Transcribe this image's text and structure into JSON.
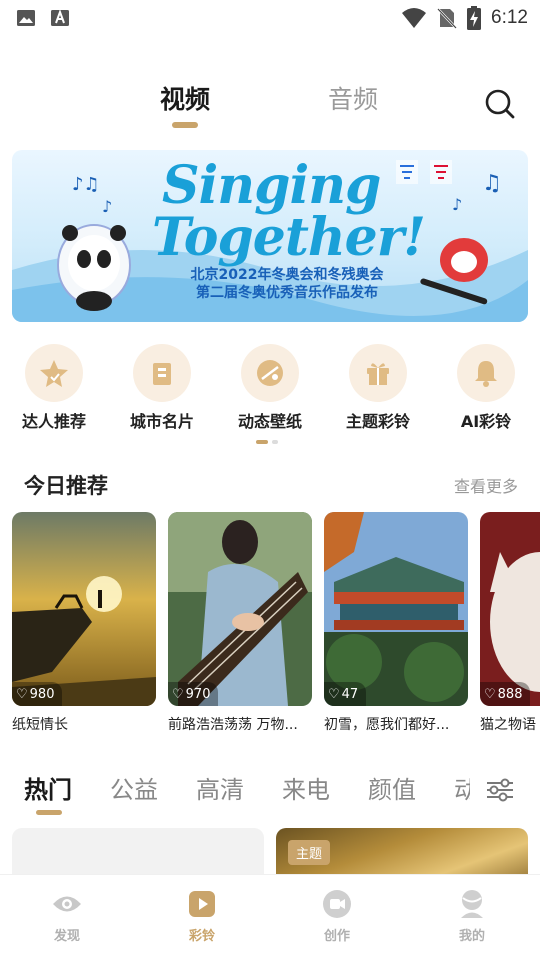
{
  "status_bar": {
    "time": "6:12",
    "icons": [
      "image-icon",
      "text-a-icon",
      "wifi-icon",
      "no-sim-icon",
      "battery-charging-icon"
    ]
  },
  "top_tabs": [
    {
      "label": "视频",
      "active": true
    },
    {
      "label": "音频",
      "active": false
    }
  ],
  "banner": {
    "title_line1": "Singing",
    "title_line2": "Together!",
    "subtitle_line1": "北京2022年冬奥会和冬残奥会",
    "subtitle_line2": "第二届冬奥优秀音乐作品发布"
  },
  "categories": [
    {
      "label": "达人推荐",
      "icon": "star-icon"
    },
    {
      "label": "城市名片",
      "icon": "building-icon"
    },
    {
      "label": "动态壁纸",
      "icon": "wallpaper-icon"
    },
    {
      "label": "主题彩铃",
      "icon": "gift-icon"
    },
    {
      "label": "AI彩铃",
      "icon": "bell-icon"
    }
  ],
  "category_pager": {
    "pages": 2,
    "current": 1
  },
  "today": {
    "title": "今日推荐",
    "more": "查看更多",
    "cards": [
      {
        "title": "纸短情长",
        "likes": "980"
      },
      {
        "title": "前路浩浩荡荡 万物...",
        "likes": "970"
      },
      {
        "title": "初雪，愿我们都好...",
        "likes": "47"
      },
      {
        "title": "猫之物语",
        "likes": "888"
      }
    ]
  },
  "genres": [
    {
      "label": "热门",
      "active": true
    },
    {
      "label": "公益",
      "active": false
    },
    {
      "label": "高清",
      "active": false
    },
    {
      "label": "来电",
      "active": false
    },
    {
      "label": "颜值",
      "active": false
    },
    {
      "label": "动",
      "active": false
    }
  ],
  "content_badge": "主题",
  "bottom_nav": [
    {
      "label": "发现",
      "icon": "eye-icon",
      "active": false
    },
    {
      "label": "彩铃",
      "icon": "play-icon",
      "active": true
    },
    {
      "label": "创作",
      "icon": "video-camera-icon",
      "active": false
    },
    {
      "label": "我的",
      "icon": "user-icon",
      "active": false
    }
  ],
  "colors": {
    "accent": "#c9a46b",
    "category_bg": "#f9eee1",
    "inactive": "#b0b0b0"
  }
}
